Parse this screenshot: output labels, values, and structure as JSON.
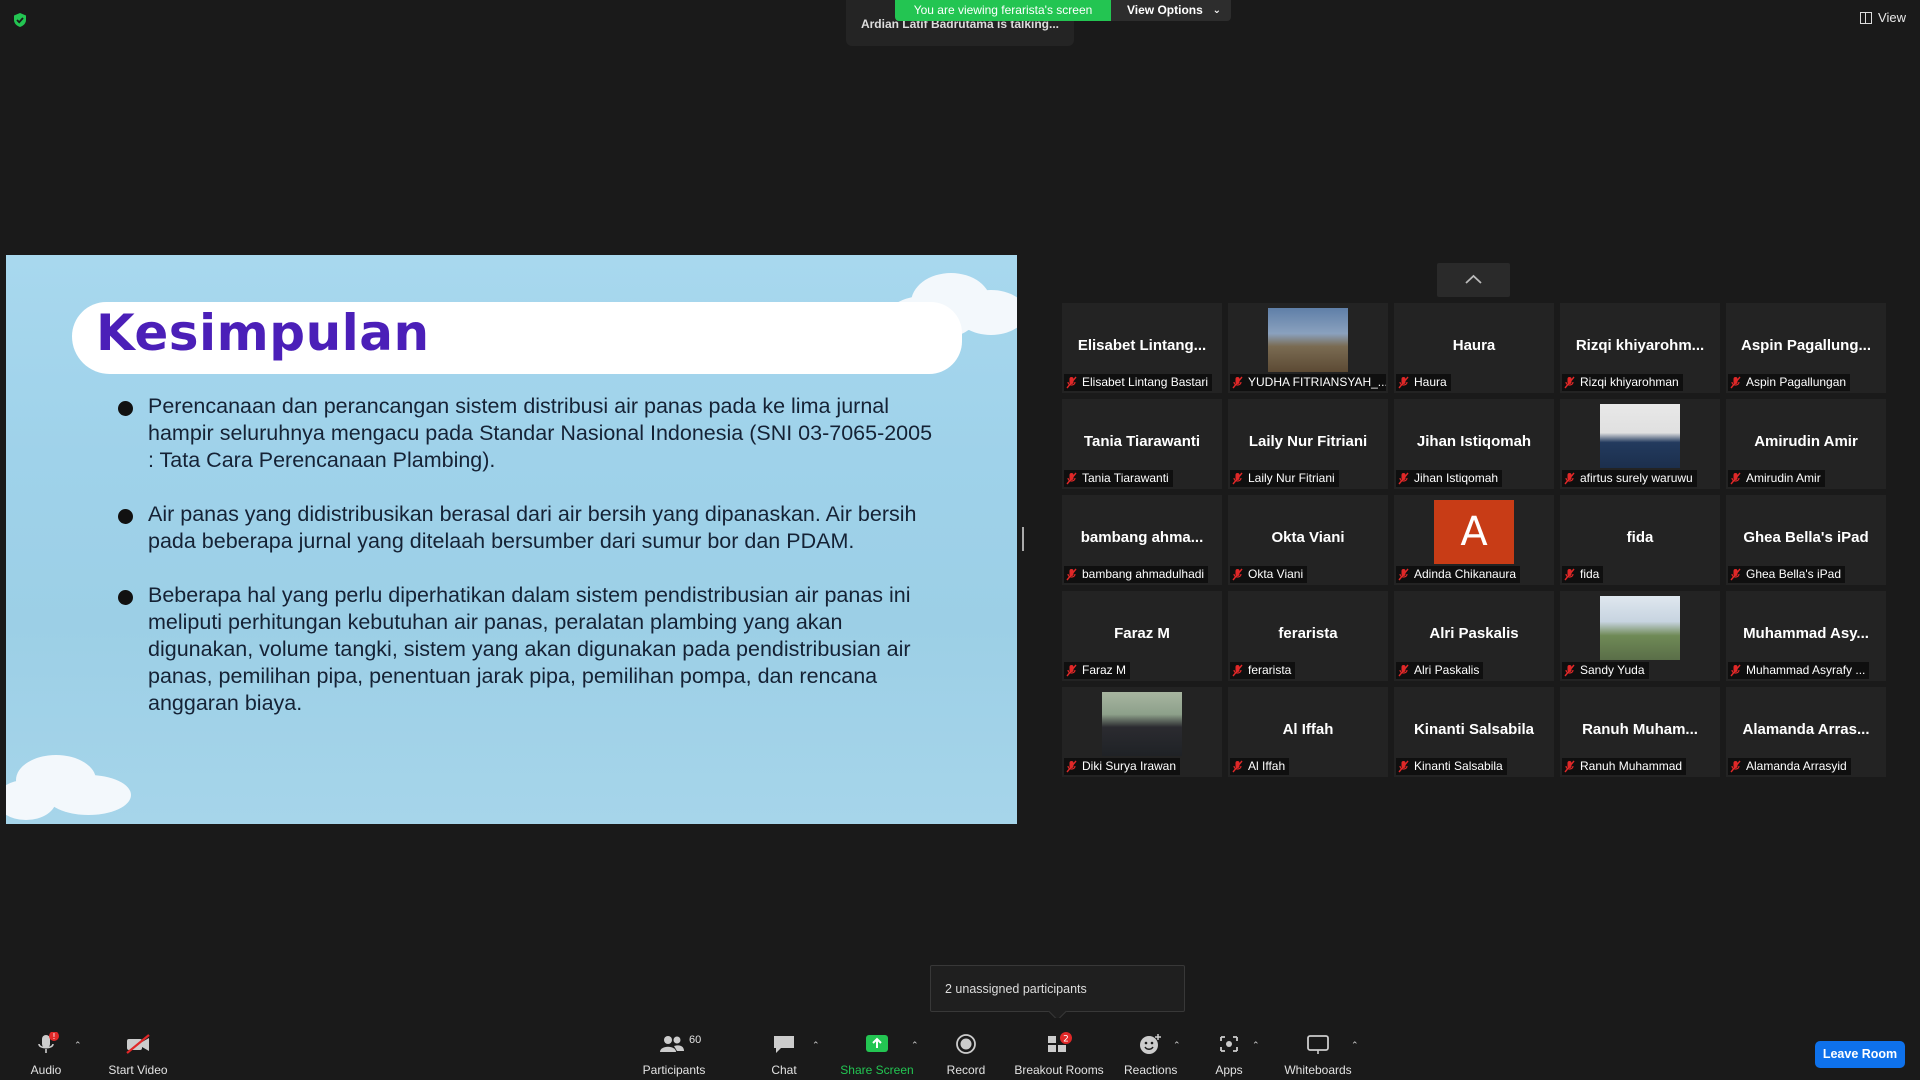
{
  "top_bar": {
    "viewing_banner": "You are viewing ferarista's screen",
    "view_options": "View Options",
    "talking": "Ardian Latif Badrutama is talking...",
    "view_label": "View"
  },
  "slide": {
    "title": "Kesimpulan",
    "bullets": [
      "Perencanaan dan perancangan sistem distribusi air panas pada ke lima jurnal hampir seluruhnya mengacu pada Standar Nasional Indonesia (SNI 03-7065-2005 : Tata Cara Perencanaan Plambing).",
      "Air panas yang didistribusikan berasal dari air bersih yang dipanaskan. Air bersih pada beberapa jurnal yang ditelaah bersumber dari sumur bor dan PDAM.",
      "Beberapa hal yang perlu diperhatikan dalam sistem pendistribusian air panas ini meliputi perhitungan kebutuhan air panas, peralatan plambing yang akan digunakan, volume tangki, sistem yang akan digunakan pada pendistribusian air panas, pemilihan pipa, penentuan jarak pipa, pemilihan pompa, dan rencana anggaran biaya."
    ]
  },
  "gallery": {
    "tiles": [
      {
        "big": "Elisabet Lintang...",
        "label": "Elisabet Lintang Bastari"
      },
      {
        "big": "",
        "label": "YUDHA FITRIANSYAH_...",
        "photo": "landscape-photo"
      },
      {
        "big": "Haura",
        "label": "Haura"
      },
      {
        "big": "Rizqi khiyarohm...",
        "label": "Rizqi khiyarohman"
      },
      {
        "big": "Aspin Pagallung...",
        "label": "Aspin Pagallungan"
      },
      {
        "big": "Tania Tiarawanti",
        "label": "Tania Tiarawanti"
      },
      {
        "big": "Laily Nur Fitriani",
        "label": "Laily Nur Fitriani"
      },
      {
        "big": "Jihan Istiqomah",
        "label": "Jihan Istiqomah"
      },
      {
        "big": "",
        "label": "afirtus surely waruwu",
        "photo": "person-photo"
      },
      {
        "big": "Amirudin Amir",
        "label": "Amirudin Amir"
      },
      {
        "big": "bambang ahma...",
        "label": "bambang ahmadulhadi"
      },
      {
        "big": "Okta Viani",
        "label": "Okta Viani"
      },
      {
        "big": "",
        "label": "Adinda Chikanaura",
        "avatar_letter": "A"
      },
      {
        "big": "fida",
        "label": "fida"
      },
      {
        "big": "Ghea Bella's iPad",
        "label": "Ghea Bella's iPad"
      },
      {
        "big": "Faraz M",
        "label": "Faraz M"
      },
      {
        "big": "ferarista",
        "label": "ferarista"
      },
      {
        "big": "Alri Paskalis",
        "label": "Alri Paskalis"
      },
      {
        "big": "",
        "label": "Sandy Yuda",
        "photo": "oilfield-photo"
      },
      {
        "big": "Muhammad Asy...",
        "label": "Muhammad Asyrafy ..."
      },
      {
        "big": "",
        "label": "Diki Surya Irawan",
        "photo": "portrait-photo"
      },
      {
        "big": "Al Iffah",
        "label": "Al Iffah"
      },
      {
        "big": "Kinanti Salsabila",
        "label": "Kinanti Salsabila"
      },
      {
        "big": "Ranuh Muham...",
        "label": "Ranuh Muhammad"
      },
      {
        "big": "Alamanda Arras...",
        "label": "Alamanda Arrasyid"
      }
    ]
  },
  "tooltip": "2 unassigned participants",
  "toolbar": {
    "audio": "Audio",
    "audio_badge": "!",
    "start_video": "Start Video",
    "participants": "Participants",
    "participants_count": "60",
    "chat": "Chat",
    "share_screen": "Share Screen",
    "record": "Record",
    "breakout_rooms": "Breakout Rooms",
    "breakout_badge": "2",
    "reactions": "Reactions",
    "apps": "Apps",
    "whiteboards": "Whiteboards",
    "leave_room": "Leave Room"
  },
  "colors": {
    "share_green": "#23c552",
    "leave_blue": "#0e71eb",
    "title_purple": "#4b1fb8",
    "muted_red": "#e02828",
    "avatar_orange": "#c83c16"
  }
}
